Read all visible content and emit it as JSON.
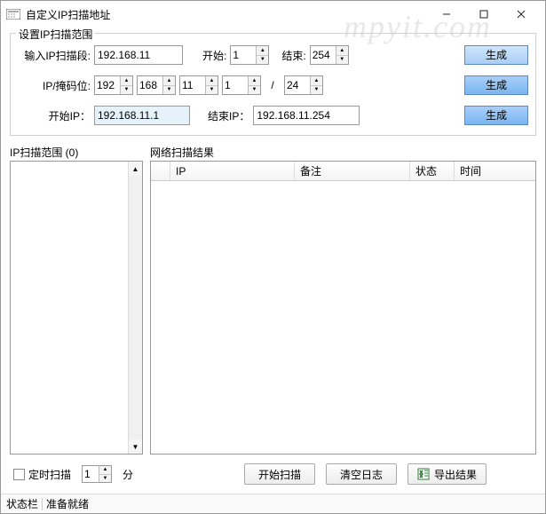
{
  "window": {
    "title": "自定义IP扫描地址"
  },
  "watermark": "mpyit.com",
  "group": {
    "title": "设置IP扫描范围"
  },
  "row1": {
    "label_segment": "输入IP扫描段:",
    "segment_value": "192.168.11",
    "label_start": "开始:",
    "start_value": "1",
    "label_end": "结束:",
    "end_value": "254",
    "btn": "生成"
  },
  "row2": {
    "label": "IP/掩码位:",
    "o1": "192",
    "o2": "168",
    "o3": "11",
    "o4": "1",
    "slash": "/",
    "mask": "24",
    "btn": "生成"
  },
  "row3": {
    "label_startip": "开始IP：",
    "startip_value": "192.168.11.1",
    "label_endip": "结束IP：",
    "endip_value": "192.168.11.254",
    "btn": "生成"
  },
  "left": {
    "title": "IP扫描范围 (0)"
  },
  "right": {
    "title": "网络扫描结果",
    "columns": {
      "ip": "IP",
      "remark": "备注",
      "status": "状态",
      "time": "时间"
    }
  },
  "bottom": {
    "timed_scan": "定时扫描",
    "timed_value": "1",
    "timed_unit": "分",
    "btn_start": "开始扫描",
    "btn_clear": "清空日志",
    "btn_export": "导出结果"
  },
  "status": {
    "label": "状态栏",
    "text": "准备就绪"
  }
}
